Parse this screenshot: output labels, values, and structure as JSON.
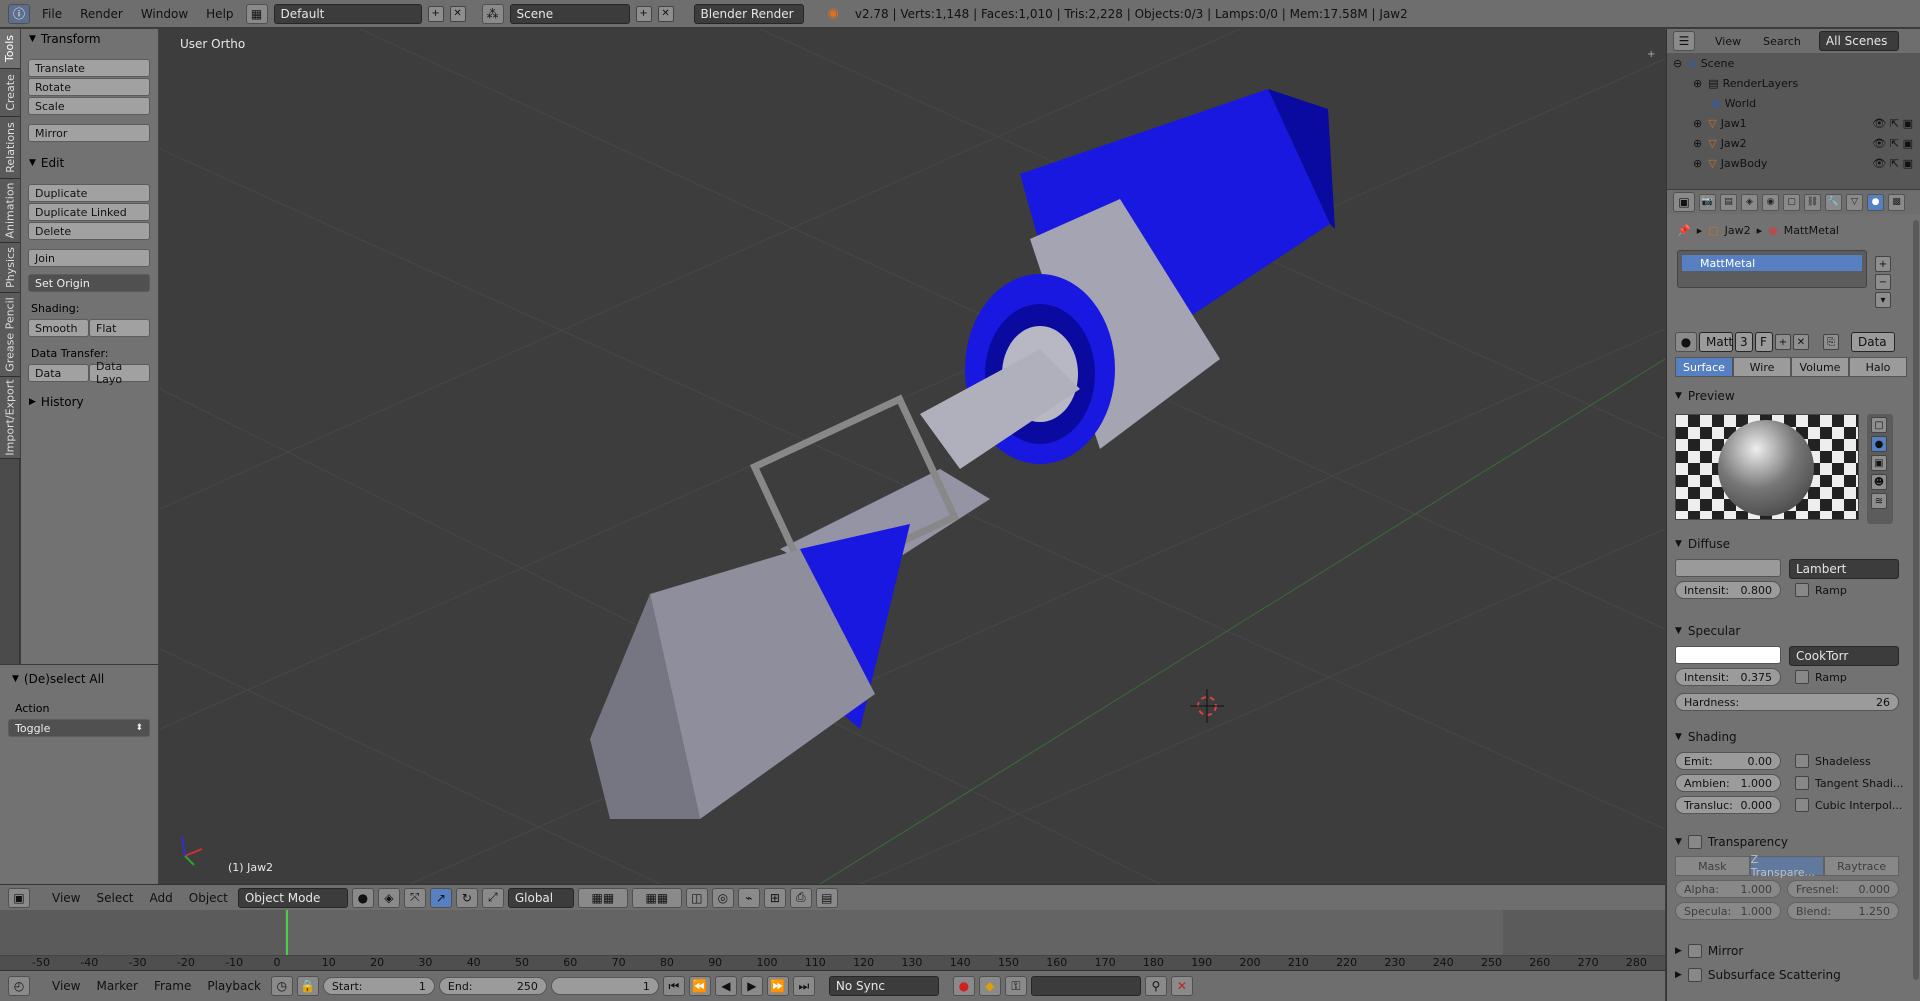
{
  "top": {
    "menus": [
      "File",
      "Render",
      "Window",
      "Help"
    ],
    "layout": "Default",
    "scene": "Scene",
    "engine": "Blender Render",
    "info": "v2.78 | Verts:1,148 | Faces:1,010 | Tris:2,228 | Objects:0/3 | Lamps:0/0 | Mem:17.58M | Jaw2"
  },
  "tabs": [
    "Tools",
    "Create",
    "Relations",
    "Animation",
    "Physics",
    "Grease Pencil",
    "Import/Export"
  ],
  "tools": {
    "transform": "Transform",
    "translate": "Translate",
    "rotate": "Rotate",
    "scale": "Scale",
    "mirror": "Mirror",
    "edit": "Edit",
    "duplicate": "Duplicate",
    "duplicate_linked": "Duplicate Linked",
    "delete": "Delete",
    "join": "Join",
    "set_origin": "Set Origin",
    "shading": "Shading:",
    "smooth": "Smooth",
    "flat": "Flat",
    "data_transfer": "Data Transfer:",
    "data": "Data",
    "data_layo": "Data Layo",
    "history": "History"
  },
  "operator": {
    "title": "(De)select All",
    "action_label": "Action",
    "action_value": "Toggle"
  },
  "viewport": {
    "title": "User Ortho",
    "object": "(1) Jaw2"
  },
  "v3d": {
    "menus": [
      "View",
      "Select",
      "Add",
      "Object"
    ],
    "mode": "Object Mode",
    "orientation": "Global"
  },
  "timeline": {
    "ticks": [
      "-50",
      "-40",
      "-30",
      "-20",
      "-10",
      "0",
      "10",
      "20",
      "30",
      "40",
      "50",
      "60",
      "70",
      "80",
      "90",
      "100",
      "110",
      "120",
      "130",
      "140",
      "150",
      "160",
      "170",
      "180",
      "190",
      "200",
      "210",
      "220",
      "230",
      "240",
      "250",
      "260",
      "270",
      "280"
    ],
    "menus": [
      "View",
      "Marker",
      "Frame",
      "Playback"
    ],
    "start": "Start:",
    "start_val": "1",
    "end": "End:",
    "end_val": "250",
    "current": "1",
    "sync": "No Sync"
  },
  "outliner": {
    "menus": [
      "View",
      "Search"
    ],
    "filter": "All Scenes",
    "items": [
      "Scene",
      "RenderLayers",
      "World",
      "Jaw1",
      "Jaw2",
      "JawBody"
    ]
  },
  "props": {
    "crumb_obj": "Jaw2",
    "crumb_mat": "MattMetal",
    "slot": "MattMetal",
    "mat_name": "Matt",
    "users": "3",
    "fake": "F",
    "link": "Data",
    "types": [
      "Surface",
      "Wire",
      "Volume",
      "Halo"
    ],
    "preview": "Preview",
    "diffuse": "Diffuse",
    "diffuse_shader": "Lambert",
    "diffuse_int": "Intensit:",
    "diffuse_int_val": "0.800",
    "ramp": "Ramp",
    "specular": "Specular",
    "spec_shader": "CookTorr",
    "spec_int": "Intensit:",
    "spec_int_val": "0.375",
    "hardness": "Hardness:",
    "hardness_val": "26",
    "shading": "Shading",
    "emit": "Emit:",
    "emit_val": "0.00",
    "ambient": "Ambien:",
    "ambient_val": "1.000",
    "transluc": "Transluc:",
    "transluc_val": "0.000",
    "shadeless": "Shadeless",
    "tangent": "Tangent Shadi...",
    "cubic": "Cubic Interpol...",
    "transparency": "Transparency",
    "trans_modes": [
      "Mask",
      "Z Transpare...",
      "Raytrace"
    ],
    "alpha": "Alpha:",
    "alpha_val": "1.000",
    "fresnel": "Fresnel:",
    "fresnel_val": "0.000",
    "specula": "Specula:",
    "specula_val": "1.000",
    "blend": "Blend:",
    "blend_val": "1.250",
    "mirror": "Mirror",
    "sss": "Subsurface Scattering"
  },
  "colors": {
    "accent": "#5680c2",
    "blue": "#1414d8",
    "metal": "#a8a8b4"
  }
}
